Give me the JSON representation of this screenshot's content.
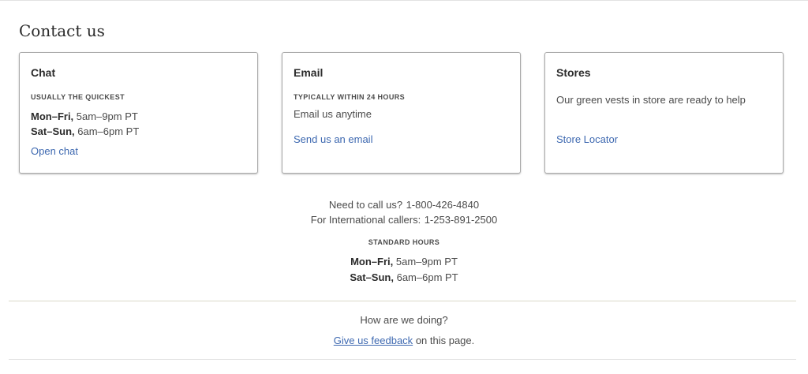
{
  "page": {
    "title": "Contact us"
  },
  "cards": {
    "chat": {
      "title": "Chat",
      "eyebrow": "USUALLY THE QUICKEST",
      "weekday_label": "Mon–Fri,",
      "weekday_hours": "5am–9pm PT",
      "weekend_label": "Sat–Sun,",
      "weekend_hours": "6am–6pm PT",
      "link": "Open chat"
    },
    "email": {
      "title": "Email",
      "eyebrow": "TYPICALLY WITHIN 24 HOURS",
      "text": "Email us anytime",
      "link": "Send us an email"
    },
    "stores": {
      "title": "Stores",
      "text": "Our green vests in store are ready to help",
      "link": "Store Locator"
    }
  },
  "phone": {
    "domestic_label": "Need to call us?",
    "domestic_number": "1-800-426-4840",
    "intl_label": "For International callers:",
    "intl_number": "1-253-891-2500"
  },
  "standard_hours": {
    "label": "STANDARD HOURS",
    "weekday_label": "Mon–Fri,",
    "weekday_hours": "5am–9pm PT",
    "weekend_label": "Sat–Sun,",
    "weekend_hours": "6am–6pm PT"
  },
  "feedback": {
    "question": "How are we doing?",
    "link": "Give us feedback",
    "suffix": "on this page."
  },
  "colors": {
    "link": "#3d68b0",
    "text": "#4b4b4b",
    "heading": "#2b2b2b",
    "card_border": "#a9a9a9",
    "divider": "#dad9c8"
  }
}
